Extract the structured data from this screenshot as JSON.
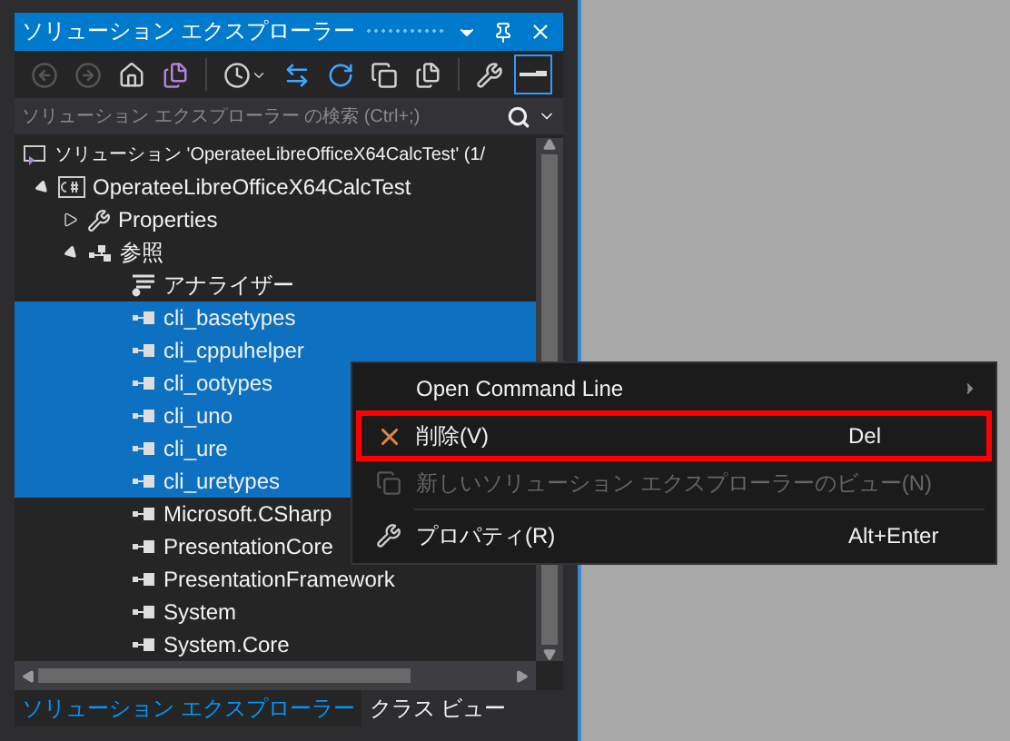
{
  "window": {
    "title": "ソリューション エクスプローラー"
  },
  "toolbar": [
    {
      "kind": "back",
      "disabled": true,
      "on": false
    },
    {
      "kind": "forward",
      "disabled": true,
      "on": false
    },
    {
      "kind": "home",
      "on": false
    },
    {
      "kind": "solution-switch",
      "on": false
    },
    {
      "kind": "separator"
    },
    {
      "kind": "pending-changes",
      "on": false
    },
    {
      "kind": "sync",
      "on": false
    },
    {
      "kind": "refresh",
      "on": false
    },
    {
      "kind": "collapse",
      "on": false
    },
    {
      "kind": "show-files",
      "on": false
    },
    {
      "kind": "separator"
    },
    {
      "kind": "properties",
      "on": false
    },
    {
      "kind": "preview",
      "on": true
    }
  ],
  "search": {
    "placeholder": "ソリューション エクスプローラー の検索 (Ctrl+;)"
  },
  "tree": [
    {
      "kind": "solution",
      "label": "ソリューション 'OperateeLibreOfficeX64CalcTest' (1/",
      "selected": false,
      "children": [
        {
          "kind": "project",
          "label": "OperateeLibreOfficeX64CalcTest",
          "selected": false,
          "expanded": true,
          "children": [
            {
              "kind": "properties",
              "label": "Properties",
              "selected": false,
              "expanded": false
            },
            {
              "kind": "references",
              "label": "参照",
              "selected": false,
              "expanded": true,
              "children": [
                {
                  "kind": "analyzer",
                  "label": "アナライザー",
                  "selected": false
                },
                {
                  "kind": "reference",
                  "label": "cli_basetypes",
                  "selected": true
                },
                {
                  "kind": "reference",
                  "label": "cli_cppuhelper",
                  "selected": true
                },
                {
                  "kind": "reference",
                  "label": "cli_ootypes",
                  "selected": true
                },
                {
                  "kind": "reference",
                  "label": "cli_uno",
                  "selected": true
                },
                {
                  "kind": "reference",
                  "label": "cli_ure",
                  "selected": true
                },
                {
                  "kind": "reference",
                  "label": "cli_uretypes",
                  "selected": true
                },
                {
                  "kind": "reference",
                  "label": "Microsoft.CSharp",
                  "selected": false
                },
                {
                  "kind": "reference",
                  "label": "PresentationCore",
                  "selected": false
                },
                {
                  "kind": "reference",
                  "label": "PresentationFramework",
                  "selected": false
                },
                {
                  "kind": "reference",
                  "label": "System",
                  "selected": false
                },
                {
                  "kind": "reference",
                  "label": "System.Core",
                  "selected": false
                }
              ]
            }
          ]
        }
      ]
    }
  ],
  "context_menu": {
    "items": [
      {
        "kind": "command",
        "label": "Open Command Line",
        "submenu": true,
        "highlighted": false,
        "disabled": false
      },
      {
        "kind": "delete",
        "label": "削除(V)",
        "shortcut": "Del",
        "highlighted": true,
        "disabled": false
      },
      {
        "kind": "new-view",
        "label": "新しいソリューション エクスプローラーのビュー(N)",
        "highlighted": false,
        "disabled": true
      },
      {
        "kind": "separator"
      },
      {
        "kind": "properties",
        "label": "プロパティ(R)",
        "shortcut": "Alt+Enter",
        "highlighted": false,
        "disabled": false
      }
    ]
  },
  "bottom_tabs": [
    {
      "label": "ソリューション エクスプローラー",
      "selected": true
    },
    {
      "label": "クラス ビュー",
      "selected": false
    }
  ]
}
